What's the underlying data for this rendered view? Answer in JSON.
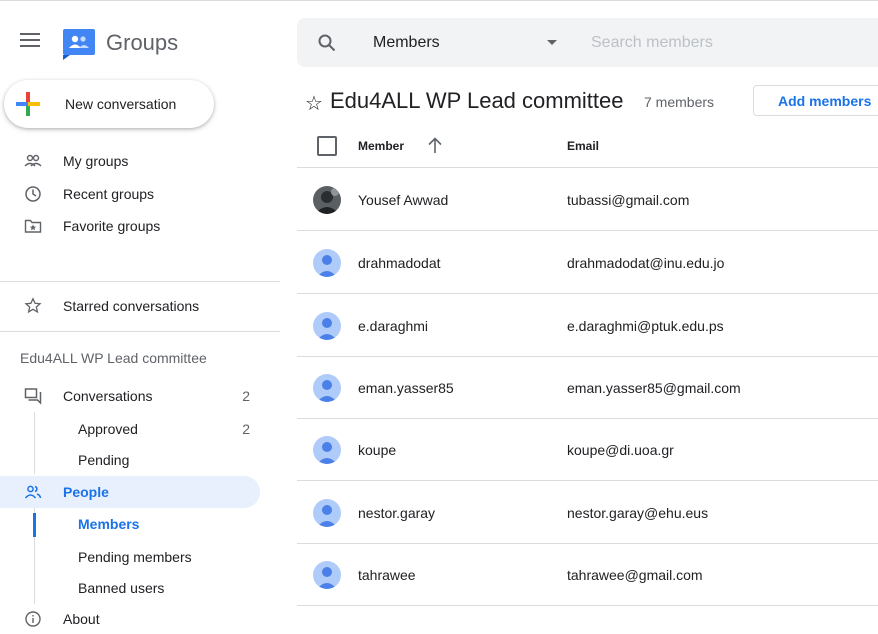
{
  "app": {
    "title": "Groups"
  },
  "sidebar": {
    "new_conversation": "New conversation",
    "nav": [
      {
        "label": "My groups",
        "icon": "people-outline-icon"
      },
      {
        "label": "Recent groups",
        "icon": "clock-icon"
      },
      {
        "label": "Favorite groups",
        "icon": "star-folder-icon"
      },
      {
        "label": "Starred conversations",
        "icon": "star-outline-icon"
      }
    ],
    "group_name": "Edu4ALL WP Lead committee",
    "conversations": {
      "label": "Conversations",
      "count": "2"
    },
    "approved": {
      "label": "Approved",
      "count": "2"
    },
    "pending": {
      "label": "Pending"
    },
    "people": {
      "label": "People"
    },
    "members": {
      "label": "Members"
    },
    "pending_members": {
      "label": "Pending members"
    },
    "banned_users": {
      "label": "Banned users"
    },
    "about": {
      "label": "About"
    }
  },
  "search": {
    "scope": "Members",
    "placeholder": "Search members"
  },
  "header": {
    "star": "☆",
    "title": "Edu4ALL WP Lead committee",
    "member_count": "7 members",
    "add_members": "Add members"
  },
  "table": {
    "col_member": "Member",
    "col_email": "Email",
    "rows": [
      {
        "name": "Yousef Awwad",
        "email": "tubassi@gmail.com",
        "avatar": "photo"
      },
      {
        "name": "drahmadodat",
        "email": "drahmadodat@inu.edu.jo",
        "avatar": "default"
      },
      {
        "name": "e.daraghmi",
        "email": "e.daraghmi@ptuk.edu.ps",
        "avatar": "default"
      },
      {
        "name": "eman.yasser85",
        "email": "eman.yasser85@gmail.com",
        "avatar": "default"
      },
      {
        "name": "koupe",
        "email": "koupe@di.uoa.gr",
        "avatar": "default"
      },
      {
        "name": "nestor.garay",
        "email": "nestor.garay@ehu.eus",
        "avatar": "default"
      },
      {
        "name": "tahrawee",
        "email": "tahrawee@gmail.com",
        "avatar": "default"
      }
    ]
  },
  "colors": {
    "accent": "#1a73e8",
    "active_bg": "#e8f0fe",
    "avatar_blue": "#4a80e8"
  }
}
